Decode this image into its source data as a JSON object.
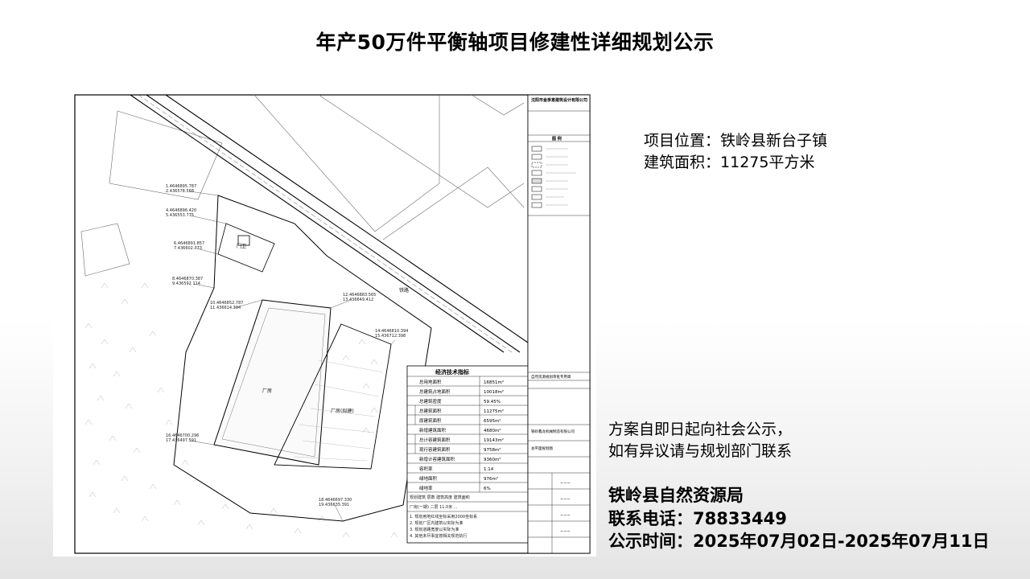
{
  "title": "年产50万件平衡轴项目修建性详细规划公示",
  "project_info": {
    "location_label": "项目位置：",
    "location_value": "铁岭县新台子镇",
    "area_label": "建筑面积：",
    "area_value": "11275平方米"
  },
  "notice": {
    "line1": "方案自即日起向社会公示，",
    "line2": "如有异议请与规划部门联系"
  },
  "agency": {
    "name": "铁岭县自然资源局",
    "phone_label": "联系电话：",
    "phone_value": "78833449",
    "period_label": "公示时间：",
    "period_value": "2025年07月02日-2025年07月11日"
  },
  "plan_table": {
    "title": "经济技术指标",
    "rows": [
      {
        "label": "总用地面积",
        "value": "16851m²"
      },
      {
        "label": "总建筑占地面积",
        "value": "10018m²"
      },
      {
        "label": "总建筑密度",
        "value": "59.45%"
      },
      {
        "label": "总建筑面积",
        "value": "11275m²"
      },
      {
        "label": "原建筑面积",
        "value": "6595m²"
      },
      {
        "label": "新增建筑面积",
        "value": "4680m²"
      },
      {
        "label": "总计容建筑面积",
        "value": "19143m²"
      },
      {
        "label": "现行容建筑面积",
        "value": "9758m²"
      },
      {
        "label": "新增计容建筑面积",
        "value": "9360m²"
      },
      {
        "label": "容积率",
        "value": "1.14"
      },
      {
        "label": "绿地面积",
        "value": "976m²"
      },
      {
        "label": "绿地率",
        "value": "6%"
      }
    ]
  },
  "title_block": {
    "company": "沈阳市金季意建筑设计有限公司",
    "legend_title": "图 例",
    "approval": "自然资源规划审批专用章",
    "project_name": "铁岭鑫龙机械制造有限公司",
    "drawing_name": "总平面规划图"
  }
}
